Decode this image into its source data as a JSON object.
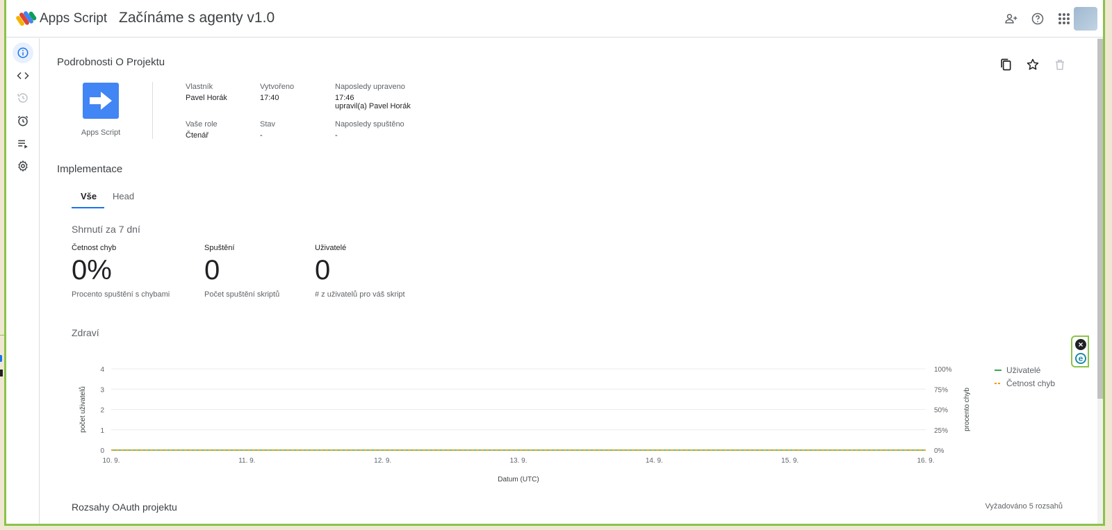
{
  "header": {
    "app_name": "Apps Script",
    "project_title": "Začínáme s agenty v1.0",
    "icons": [
      "share-user-icon",
      "help-icon",
      "apps-grid-icon",
      "avatar"
    ]
  },
  "rail": {
    "items": [
      {
        "name": "overview",
        "icon": "info-icon",
        "active": true
      },
      {
        "name": "editor",
        "icon": "code-icon"
      },
      {
        "name": "history",
        "icon": "history-icon"
      },
      {
        "name": "triggers",
        "icon": "alarm-icon"
      },
      {
        "name": "executions",
        "icon": "executions-icon"
      },
      {
        "name": "settings",
        "icon": "gear-icon"
      }
    ]
  },
  "details": {
    "title": "Podrobnosti O Projektu",
    "project_icon_label": "Apps Script",
    "owner_label": "Vlastník",
    "owner_value": "Pavel Horák",
    "created_label": "Vytvořeno",
    "created_value": "17:40",
    "modified_label": "Naposledy upraveno",
    "modified_value": "17:46",
    "modified_by": "upravil(a) Pavel Horák",
    "role_label": "Vaše role",
    "role_value": "Čtenář",
    "status_label": "Stav",
    "status_value": "-",
    "last_run_label": "Naposledy spuštěno",
    "last_run_value": "-"
  },
  "deployments": {
    "title": "Implementace",
    "tabs": [
      {
        "label": "Vše",
        "active": true
      },
      {
        "label": "Head",
        "active": false
      }
    ]
  },
  "summary": {
    "title": "Shrnutí za 7 dní",
    "metrics": [
      {
        "label": "Četnost chyb",
        "value": "0%",
        "desc": "Procento spuštění s chybami"
      },
      {
        "label": "Spuštění",
        "value": "0",
        "desc": "Počet spuštění skriptů"
      },
      {
        "label": "Uživatelé",
        "value": "0",
        "desc": "# z uživatelů pro váš skript"
      }
    ]
  },
  "health": {
    "title": "Zdraví"
  },
  "chart_data": {
    "type": "line",
    "x": [
      "10. 9.",
      "11. 9.",
      "12. 9.",
      "13. 9.",
      "14. 9.",
      "15. 9.",
      "16. 9."
    ],
    "xlabel": "Datum (UTC)",
    "ylabel": "počet uživatelů",
    "ylabel_right": "procento chyb",
    "y_ticks": [
      "0",
      "1",
      "2",
      "3",
      "4"
    ],
    "y_right_ticks": [
      "0%",
      "25%",
      "50%",
      "75%",
      "100%"
    ],
    "ylim": [
      0,
      4
    ],
    "ylim_right": [
      0,
      100
    ],
    "grid": true,
    "legend_position": "right",
    "series": [
      {
        "name": "Uživatelé",
        "values": [
          0,
          0,
          0,
          0,
          0,
          0,
          0
        ],
        "color": "#34a853",
        "axis": "left"
      },
      {
        "name": "Četnost chyb",
        "values": [
          0,
          0,
          0,
          0,
          0,
          0,
          0
        ],
        "color": "#f29900",
        "axis": "right",
        "dashed": true
      }
    ]
  },
  "oauth": {
    "title": "Rozsahy OAuth projektu",
    "count_text": "Vyžadováno 5 rozsahů"
  },
  "colors": {
    "accent": "#1a73e8",
    "frame": "#8bc34a",
    "project_icon": "#4285f4"
  }
}
